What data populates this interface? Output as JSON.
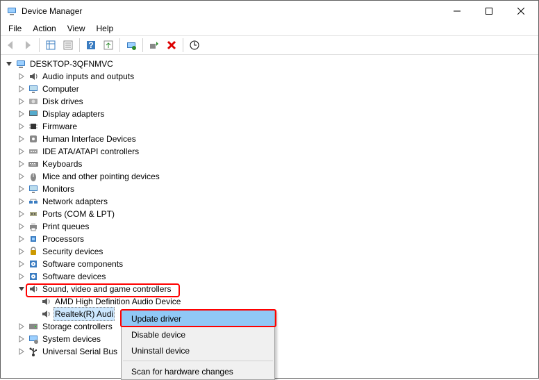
{
  "title": "Device Manager",
  "window_controls": {
    "minimize": "—",
    "maximize": "▢",
    "close": "✕"
  },
  "menubar": [
    "File",
    "Action",
    "View",
    "Help"
  ],
  "toolbar": [
    {
      "name": "back-icon",
      "enabled": false
    },
    {
      "name": "forward-icon",
      "enabled": false
    },
    {
      "name": "sep"
    },
    {
      "name": "show-hide-tree-icon",
      "enabled": true
    },
    {
      "name": "properties-icon",
      "enabled": true
    },
    {
      "name": "sep"
    },
    {
      "name": "help-icon",
      "enabled": true
    },
    {
      "name": "export-icon",
      "enabled": true
    },
    {
      "name": "sep"
    },
    {
      "name": "update-driver-icon",
      "enabled": true
    },
    {
      "name": "sep"
    },
    {
      "name": "uninstall-icon",
      "enabled": true
    },
    {
      "name": "delete-icon",
      "enabled": true
    },
    {
      "name": "sep"
    },
    {
      "name": "scan-hardware-icon",
      "enabled": true
    }
  ],
  "root": {
    "label": "DESKTOP-3QFNMVC",
    "icon": "computer-icon",
    "expanded": true,
    "children": [
      {
        "label": "Audio inputs and outputs",
        "icon": "speaker-icon",
        "exp": ">"
      },
      {
        "label": "Computer",
        "icon": "monitor-icon",
        "exp": ">"
      },
      {
        "label": "Disk drives",
        "icon": "disk-icon",
        "exp": ">"
      },
      {
        "label": "Display adapters",
        "icon": "display-icon",
        "exp": ">"
      },
      {
        "label": "Firmware",
        "icon": "chip-icon",
        "exp": ">"
      },
      {
        "label": "Human Interface Devices",
        "icon": "hid-icon",
        "exp": ">"
      },
      {
        "label": "IDE ATA/ATAPI controllers",
        "icon": "ide-icon",
        "exp": ">"
      },
      {
        "label": "Keyboards",
        "icon": "keyboard-icon",
        "exp": ">"
      },
      {
        "label": "Mice and other pointing devices",
        "icon": "mouse-icon",
        "exp": ">"
      },
      {
        "label": "Monitors",
        "icon": "monitor-icon",
        "exp": ">"
      },
      {
        "label": "Network adapters",
        "icon": "network-icon",
        "exp": ">"
      },
      {
        "label": "Ports (COM & LPT)",
        "icon": "port-icon",
        "exp": ">"
      },
      {
        "label": "Print queues",
        "icon": "printer-icon",
        "exp": ">"
      },
      {
        "label": "Processors",
        "icon": "cpu-icon",
        "exp": ">"
      },
      {
        "label": "Security devices",
        "icon": "security-icon",
        "exp": ">"
      },
      {
        "label": "Software components",
        "icon": "software-icon",
        "exp": ">"
      },
      {
        "label": "Software devices",
        "icon": "software-icon",
        "exp": ">"
      },
      {
        "label": "Sound, video and game controllers",
        "icon": "speaker-icon",
        "exp": "v",
        "highlighted": true,
        "children": [
          {
            "label": "AMD High Definition Audio Device",
            "icon": "speaker-icon"
          },
          {
            "label": "Realtek(R) Audi",
            "icon": "speaker-icon",
            "selected": true,
            "truncated_by_menu": true
          }
        ]
      },
      {
        "label": "Storage controllers",
        "icon": "storage-icon",
        "exp": ">"
      },
      {
        "label": "System devices",
        "icon": "system-icon",
        "exp": ">"
      },
      {
        "label": "Universal Serial Bus",
        "icon": "usb-icon",
        "exp": ">",
        "truncated_by_menu": true
      }
    ]
  },
  "context_menu": {
    "items": [
      {
        "label": "Update driver",
        "state": "highlighted"
      },
      {
        "label": "Disable device",
        "state": ""
      },
      {
        "label": "Uninstall device",
        "state": ""
      },
      {
        "sep": true
      },
      {
        "label": "Scan for hardware changes",
        "state": ""
      }
    ]
  },
  "highlight_targets": {
    "sound_category": true,
    "update_driver_menu_item": true
  }
}
